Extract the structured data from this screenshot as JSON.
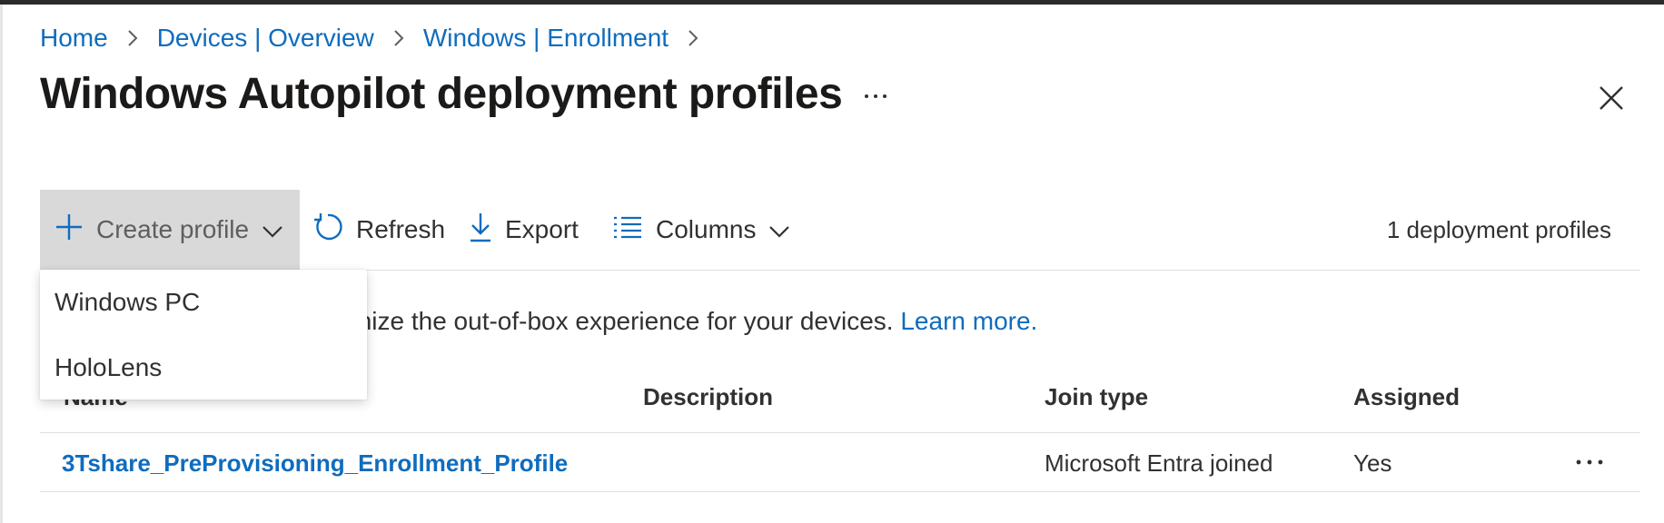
{
  "breadcrumb": {
    "items": [
      "Home",
      "Devices | Overview",
      "Windows | Enrollment"
    ]
  },
  "page": {
    "title": "Windows Autopilot deployment profiles"
  },
  "toolbar": {
    "create_label": "Create profile",
    "refresh_label": "Refresh",
    "export_label": "Export",
    "columns_label": "Columns",
    "count_text": "1 deployment profiles"
  },
  "dropdown": {
    "options": [
      "Windows PC",
      "HoloLens"
    ]
  },
  "info": {
    "text": "ent profiles lets you customize the out-of-box experience for your devices.",
    "link": "Learn more."
  },
  "table": {
    "columns": [
      "Name",
      "Description",
      "Join type",
      "Assigned"
    ],
    "rows": [
      {
        "name": "3Tshare_PreProvisioning_Enrollment_Profile",
        "description": "",
        "join_type": "Microsoft Entra joined",
        "assigned": "Yes"
      }
    ]
  },
  "colors": {
    "accent": "#0f6cbd",
    "text": "#323130",
    "create_button_bg": "#d9d9d9"
  },
  "icons": {
    "create": "plus-icon",
    "refresh": "refresh-icon",
    "export": "download-icon",
    "columns": "list-icon",
    "more": "ellipsis-icon",
    "close": "close-icon",
    "chevron": "chevron-down-icon",
    "separator": "chevron-right-icon"
  }
}
